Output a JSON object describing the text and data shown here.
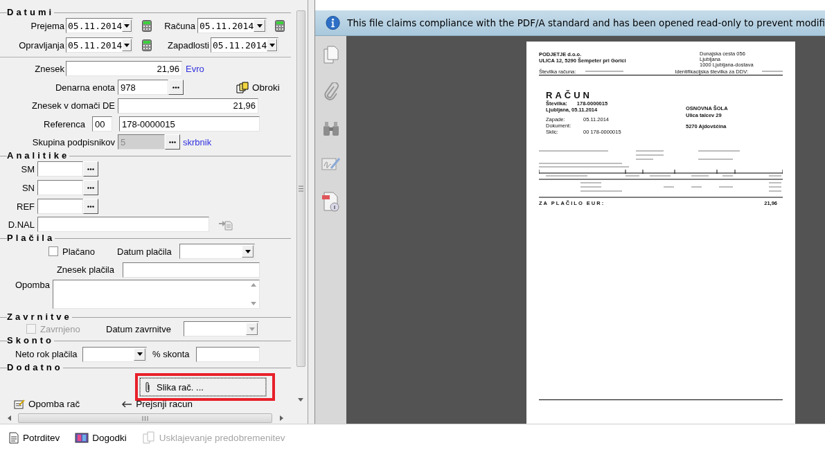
{
  "datumi": {
    "title": "Datumi",
    "prejema": {
      "label": "Prejema",
      "value": "05.11.2014"
    },
    "racuna": {
      "label": "Računa",
      "value": "05.11.2014"
    },
    "opravljanja": {
      "label": "Opravljanja",
      "value": "05.11.2014"
    },
    "zapadlosti": {
      "label": "Zapadlosti",
      "value": "05.11.2014"
    }
  },
  "zneski": {
    "znesek": {
      "label": "Znesek",
      "value": "21,96",
      "link": "Evro"
    },
    "denarna_enota": {
      "label": "Denarna enota",
      "value": "978"
    },
    "obroki": "Obroki",
    "znesek_domaci": {
      "label": "Znesek v domači DE",
      "value": "21,96"
    },
    "referenca": {
      "label": "Referenca",
      "model": "00",
      "value": "178-0000015"
    },
    "skupina": {
      "label": "Skupina podpisnikov",
      "value": "5",
      "disabled": true,
      "link": "skrbnik"
    }
  },
  "analitike": {
    "title": "Analitike",
    "fields": [
      {
        "label": "SM"
      },
      {
        "label": "SN"
      },
      {
        "label": "REF"
      }
    ],
    "d_nal": {
      "label": "D.NAL"
    }
  },
  "placila": {
    "title": "Plačila",
    "placano": {
      "label": "Plačano",
      "checked": false
    },
    "datum_placila": {
      "label": "Datum plačila"
    },
    "znesek_placila": {
      "label": "Znesek plačila"
    },
    "opomba": {
      "label": "Opomba"
    }
  },
  "zavrnitve": {
    "title": "Zavrnitve",
    "zavrnjeno": {
      "label": "Zavrnjeno",
      "checked": false,
      "disabled": true
    },
    "datum_zavrnitve": {
      "label": "Datum zavrnitve",
      "disabled": true
    }
  },
  "skonto": {
    "title": "Skonto",
    "neto_rok": {
      "label": "Neto rok plačila"
    },
    "procent": {
      "label": "% skonta"
    }
  },
  "dodatno": {
    "title": "Dodatno",
    "slika": "Slika rač. ...",
    "opomba_rac": "Opomba rač",
    "prejsnji": "Prejsnji racun"
  },
  "pdf_viewer": {
    "notice": "This file claims compliance with the PDF/A standard and has been opened read-only to prevent modifi",
    "document": {
      "company": [
        "PODJETJE d.o.o.",
        "ULICA 12, 5290 Šempeter pri Gorici"
      ],
      "address": [
        "Dunajska cesta 056",
        "Ljubljana",
        "1000 Ljubljana-dostava"
      ],
      "account_label": "Številka računa:",
      "vat_label": "Identifikacijska številka za DDV:",
      "title": "RAČUN",
      "meta": [
        {
          "label": "Številka:",
          "value": "178-0000015"
        }
      ],
      "place_date": "Ljubljana, 05.11.2014",
      "details": [
        {
          "label": "Zapade:",
          "value": "05.11.2014"
        },
        {
          "label": "Dokument:"
        },
        {
          "label": "Sklic:",
          "value": "00 178-0000015"
        }
      ],
      "recipient": [
        "OSNOVNA ŠOLA",
        "Ulica talcev 29"
      ],
      "recipient_city": "5270  Ajdovščina",
      "total_label": "ZA PLAČILO  EUR:",
      "total_value": "21,96"
    }
  },
  "toolbar": [
    {
      "label": "Potrditev",
      "disabled": false
    },
    {
      "label": "Dogodki",
      "disabled": false
    },
    {
      "label": "Usklajevanje predobremenitev",
      "disabled": true
    }
  ]
}
